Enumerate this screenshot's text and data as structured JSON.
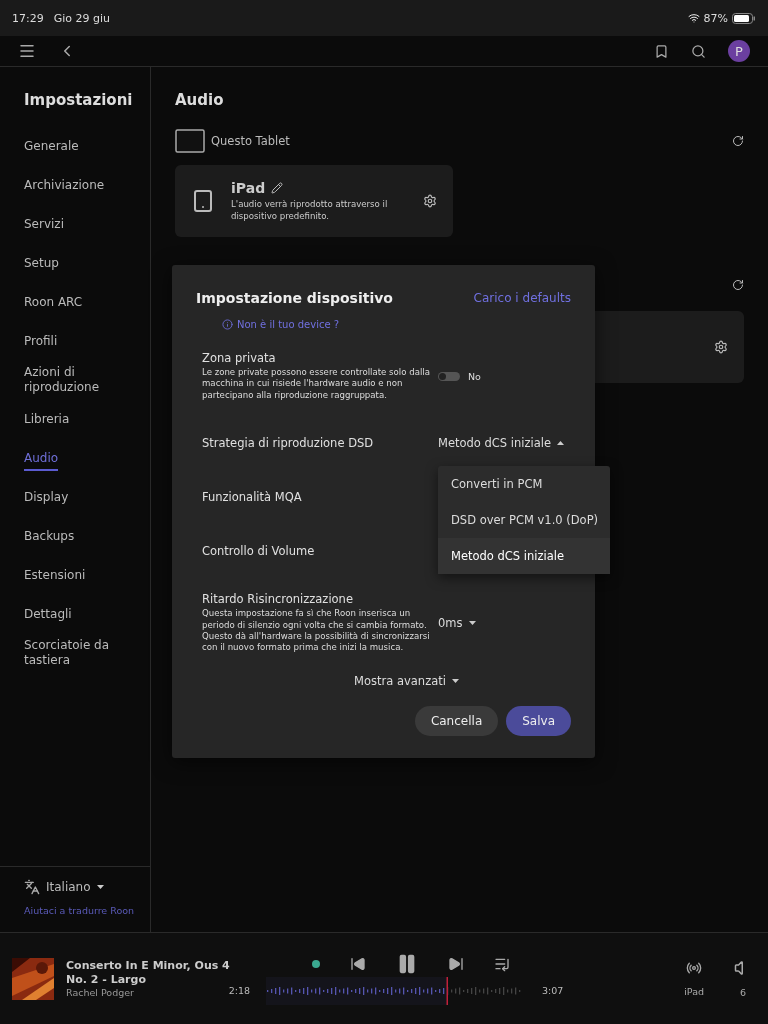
{
  "status_bar": {
    "time": "17:29",
    "date": "Gio 29 giu",
    "battery": "87%"
  },
  "top_bar": {
    "avatar": "P"
  },
  "sidebar": {
    "title": "Impostazioni",
    "items": [
      {
        "label": "Generale",
        "selected": false
      },
      {
        "label": "Archiviazione",
        "selected": false
      },
      {
        "label": "Servizi",
        "selected": false
      },
      {
        "label": "Setup",
        "selected": false
      },
      {
        "label": "Roon ARC",
        "selected": false
      },
      {
        "label": "Profili",
        "selected": false
      },
      {
        "label": "Azioni di riproduzione",
        "selected": false
      },
      {
        "label": "Libreria",
        "selected": false
      },
      {
        "label": "Audio",
        "selected": true
      },
      {
        "label": "Display",
        "selected": false
      },
      {
        "label": "Backups",
        "selected": false
      },
      {
        "label": "Estensioni",
        "selected": false
      },
      {
        "label": "Dettagli",
        "selected": false
      },
      {
        "label": "Scorciatoie da tastiera",
        "selected": false
      }
    ],
    "language": "Italiano",
    "translate_link": "Aiutaci a tradurre Roon"
  },
  "main": {
    "title": "Audio",
    "section_heading": "Questo Tablet",
    "device": {
      "name": "iPad",
      "description": "L'audio verrà riprodotto attraverso il dispositivo predefinito."
    }
  },
  "modal": {
    "title": "Impostazione dispositivo",
    "defaults_link": "Carico i defaults",
    "notice": "Non è il tuo device ?",
    "settings": [
      {
        "kind": "toggle",
        "label": "Zona privata",
        "description": "Le zone private possono essere controllate solo dalla macchina in cui risiede l'hardware audio e non partecipano alla riproduzione raggruppata.",
        "on": false,
        "value": "No"
      },
      {
        "kind": "dropdown",
        "label": "Strategia di riproduzione DSD",
        "value": "Metodo dCS iniziale",
        "expanded": true,
        "options": [
          {
            "label": "Converti in PCM",
            "selected": false
          },
          {
            "label": "DSD over PCM v1.0 (DoP)",
            "selected": false
          },
          {
            "label": "Metodo dCS iniziale",
            "selected": true
          }
        ]
      },
      {
        "kind": "plain",
        "label": "Funzionalità MQA"
      },
      {
        "kind": "plain",
        "label": "Controllo di Volume"
      },
      {
        "kind": "dropdown",
        "label": "Ritardo Risincronizzazione",
        "description": "Questa impostazione fa sì che Roon inserisca un periodo di silenzio ogni volta che si cambia formato. Questo dà all'hardware la possibilità di sincronizzarsi con il nuovo formato prima che inizi la musica.",
        "value": "0ms",
        "expanded": false
      }
    ],
    "advanced": "Mostra avanzati",
    "buttons": {
      "cancel": "Cancella",
      "save": "Salva"
    }
  },
  "player": {
    "title": "Conserto In E Minor, Ous 4 No. 2 - Largo",
    "artist": "Rachel Podger",
    "playing": true,
    "elapsed": "2:18",
    "total": "3:07",
    "progress": {
      "level": 0.7
    },
    "zone": "iPad",
    "volume": "6"
  }
}
